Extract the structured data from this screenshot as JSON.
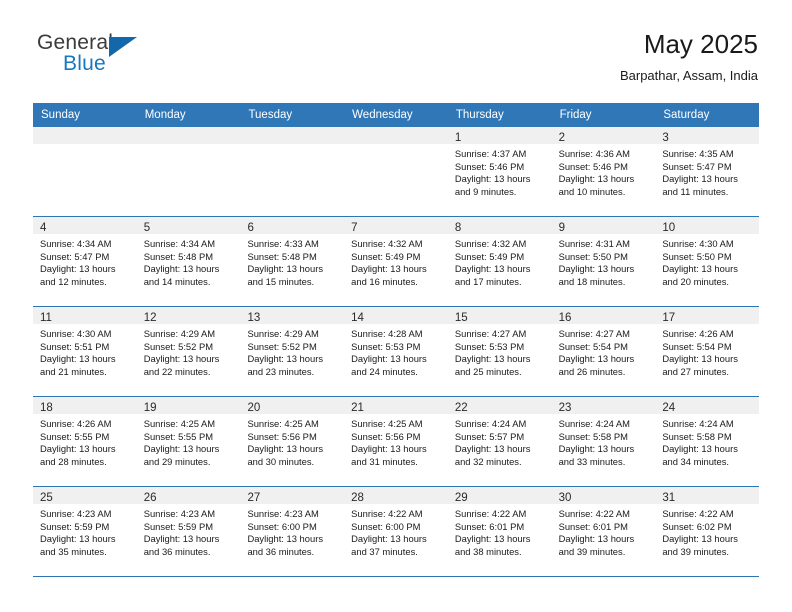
{
  "logo": {
    "word_one": "General",
    "word_two": "Blue",
    "triangle_color": "#1368ab",
    "blue_color": "#1878be"
  },
  "header": {
    "title": "May 2025",
    "subtitle": "Barpathar, Assam, India"
  },
  "theme": {
    "header_bg": "#3077b8",
    "row_divider": "#2f74b4",
    "daynum_strip_bg": "#f0f0f0"
  },
  "weekdays": [
    "Sunday",
    "Monday",
    "Tuesday",
    "Wednesday",
    "Thursday",
    "Friday",
    "Saturday"
  ],
  "weeks": [
    [
      {
        "day": "",
        "sunrise": "",
        "sunset": "",
        "daylight1": "",
        "daylight2": ""
      },
      {
        "day": "",
        "sunrise": "",
        "sunset": "",
        "daylight1": "",
        "daylight2": ""
      },
      {
        "day": "",
        "sunrise": "",
        "sunset": "",
        "daylight1": "",
        "daylight2": ""
      },
      {
        "day": "",
        "sunrise": "",
        "sunset": "",
        "daylight1": "",
        "daylight2": ""
      },
      {
        "day": "1",
        "sunrise": "Sunrise: 4:37 AM",
        "sunset": "Sunset: 5:46 PM",
        "daylight1": "Daylight: 13 hours",
        "daylight2": "and 9 minutes."
      },
      {
        "day": "2",
        "sunrise": "Sunrise: 4:36 AM",
        "sunset": "Sunset: 5:46 PM",
        "daylight1": "Daylight: 13 hours",
        "daylight2": "and 10 minutes."
      },
      {
        "day": "3",
        "sunrise": "Sunrise: 4:35 AM",
        "sunset": "Sunset: 5:47 PM",
        "daylight1": "Daylight: 13 hours",
        "daylight2": "and 11 minutes."
      }
    ],
    [
      {
        "day": "4",
        "sunrise": "Sunrise: 4:34 AM",
        "sunset": "Sunset: 5:47 PM",
        "daylight1": "Daylight: 13 hours",
        "daylight2": "and 12 minutes."
      },
      {
        "day": "5",
        "sunrise": "Sunrise: 4:34 AM",
        "sunset": "Sunset: 5:48 PM",
        "daylight1": "Daylight: 13 hours",
        "daylight2": "and 14 minutes."
      },
      {
        "day": "6",
        "sunrise": "Sunrise: 4:33 AM",
        "sunset": "Sunset: 5:48 PM",
        "daylight1": "Daylight: 13 hours",
        "daylight2": "and 15 minutes."
      },
      {
        "day": "7",
        "sunrise": "Sunrise: 4:32 AM",
        "sunset": "Sunset: 5:49 PM",
        "daylight1": "Daylight: 13 hours",
        "daylight2": "and 16 minutes."
      },
      {
        "day": "8",
        "sunrise": "Sunrise: 4:32 AM",
        "sunset": "Sunset: 5:49 PM",
        "daylight1": "Daylight: 13 hours",
        "daylight2": "and 17 minutes."
      },
      {
        "day": "9",
        "sunrise": "Sunrise: 4:31 AM",
        "sunset": "Sunset: 5:50 PM",
        "daylight1": "Daylight: 13 hours",
        "daylight2": "and 18 minutes."
      },
      {
        "day": "10",
        "sunrise": "Sunrise: 4:30 AM",
        "sunset": "Sunset: 5:50 PM",
        "daylight1": "Daylight: 13 hours",
        "daylight2": "and 20 minutes."
      }
    ],
    [
      {
        "day": "11",
        "sunrise": "Sunrise: 4:30 AM",
        "sunset": "Sunset: 5:51 PM",
        "daylight1": "Daylight: 13 hours",
        "daylight2": "and 21 minutes."
      },
      {
        "day": "12",
        "sunrise": "Sunrise: 4:29 AM",
        "sunset": "Sunset: 5:52 PM",
        "daylight1": "Daylight: 13 hours",
        "daylight2": "and 22 minutes."
      },
      {
        "day": "13",
        "sunrise": "Sunrise: 4:29 AM",
        "sunset": "Sunset: 5:52 PM",
        "daylight1": "Daylight: 13 hours",
        "daylight2": "and 23 minutes."
      },
      {
        "day": "14",
        "sunrise": "Sunrise: 4:28 AM",
        "sunset": "Sunset: 5:53 PM",
        "daylight1": "Daylight: 13 hours",
        "daylight2": "and 24 minutes."
      },
      {
        "day": "15",
        "sunrise": "Sunrise: 4:27 AM",
        "sunset": "Sunset: 5:53 PM",
        "daylight1": "Daylight: 13 hours",
        "daylight2": "and 25 minutes."
      },
      {
        "day": "16",
        "sunrise": "Sunrise: 4:27 AM",
        "sunset": "Sunset: 5:54 PM",
        "daylight1": "Daylight: 13 hours",
        "daylight2": "and 26 minutes."
      },
      {
        "day": "17",
        "sunrise": "Sunrise: 4:26 AM",
        "sunset": "Sunset: 5:54 PM",
        "daylight1": "Daylight: 13 hours",
        "daylight2": "and 27 minutes."
      }
    ],
    [
      {
        "day": "18",
        "sunrise": "Sunrise: 4:26 AM",
        "sunset": "Sunset: 5:55 PM",
        "daylight1": "Daylight: 13 hours",
        "daylight2": "and 28 minutes."
      },
      {
        "day": "19",
        "sunrise": "Sunrise: 4:25 AM",
        "sunset": "Sunset: 5:55 PM",
        "daylight1": "Daylight: 13 hours",
        "daylight2": "and 29 minutes."
      },
      {
        "day": "20",
        "sunrise": "Sunrise: 4:25 AM",
        "sunset": "Sunset: 5:56 PM",
        "daylight1": "Daylight: 13 hours",
        "daylight2": "and 30 minutes."
      },
      {
        "day": "21",
        "sunrise": "Sunrise: 4:25 AM",
        "sunset": "Sunset: 5:56 PM",
        "daylight1": "Daylight: 13 hours",
        "daylight2": "and 31 minutes."
      },
      {
        "day": "22",
        "sunrise": "Sunrise: 4:24 AM",
        "sunset": "Sunset: 5:57 PM",
        "daylight1": "Daylight: 13 hours",
        "daylight2": "and 32 minutes."
      },
      {
        "day": "23",
        "sunrise": "Sunrise: 4:24 AM",
        "sunset": "Sunset: 5:58 PM",
        "daylight1": "Daylight: 13 hours",
        "daylight2": "and 33 minutes."
      },
      {
        "day": "24",
        "sunrise": "Sunrise: 4:24 AM",
        "sunset": "Sunset: 5:58 PM",
        "daylight1": "Daylight: 13 hours",
        "daylight2": "and 34 minutes."
      }
    ],
    [
      {
        "day": "25",
        "sunrise": "Sunrise: 4:23 AM",
        "sunset": "Sunset: 5:59 PM",
        "daylight1": "Daylight: 13 hours",
        "daylight2": "and 35 minutes."
      },
      {
        "day": "26",
        "sunrise": "Sunrise: 4:23 AM",
        "sunset": "Sunset: 5:59 PM",
        "daylight1": "Daylight: 13 hours",
        "daylight2": "and 36 minutes."
      },
      {
        "day": "27",
        "sunrise": "Sunrise: 4:23 AM",
        "sunset": "Sunset: 6:00 PM",
        "daylight1": "Daylight: 13 hours",
        "daylight2": "and 36 minutes."
      },
      {
        "day": "28",
        "sunrise": "Sunrise: 4:22 AM",
        "sunset": "Sunset: 6:00 PM",
        "daylight1": "Daylight: 13 hours",
        "daylight2": "and 37 minutes."
      },
      {
        "day": "29",
        "sunrise": "Sunrise: 4:22 AM",
        "sunset": "Sunset: 6:01 PM",
        "daylight1": "Daylight: 13 hours",
        "daylight2": "and 38 minutes."
      },
      {
        "day": "30",
        "sunrise": "Sunrise: 4:22 AM",
        "sunset": "Sunset: 6:01 PM",
        "daylight1": "Daylight: 13 hours",
        "daylight2": "and 39 minutes."
      },
      {
        "day": "31",
        "sunrise": "Sunrise: 4:22 AM",
        "sunset": "Sunset: 6:02 PM",
        "daylight1": "Daylight: 13 hours",
        "daylight2": "and 39 minutes."
      }
    ]
  ]
}
